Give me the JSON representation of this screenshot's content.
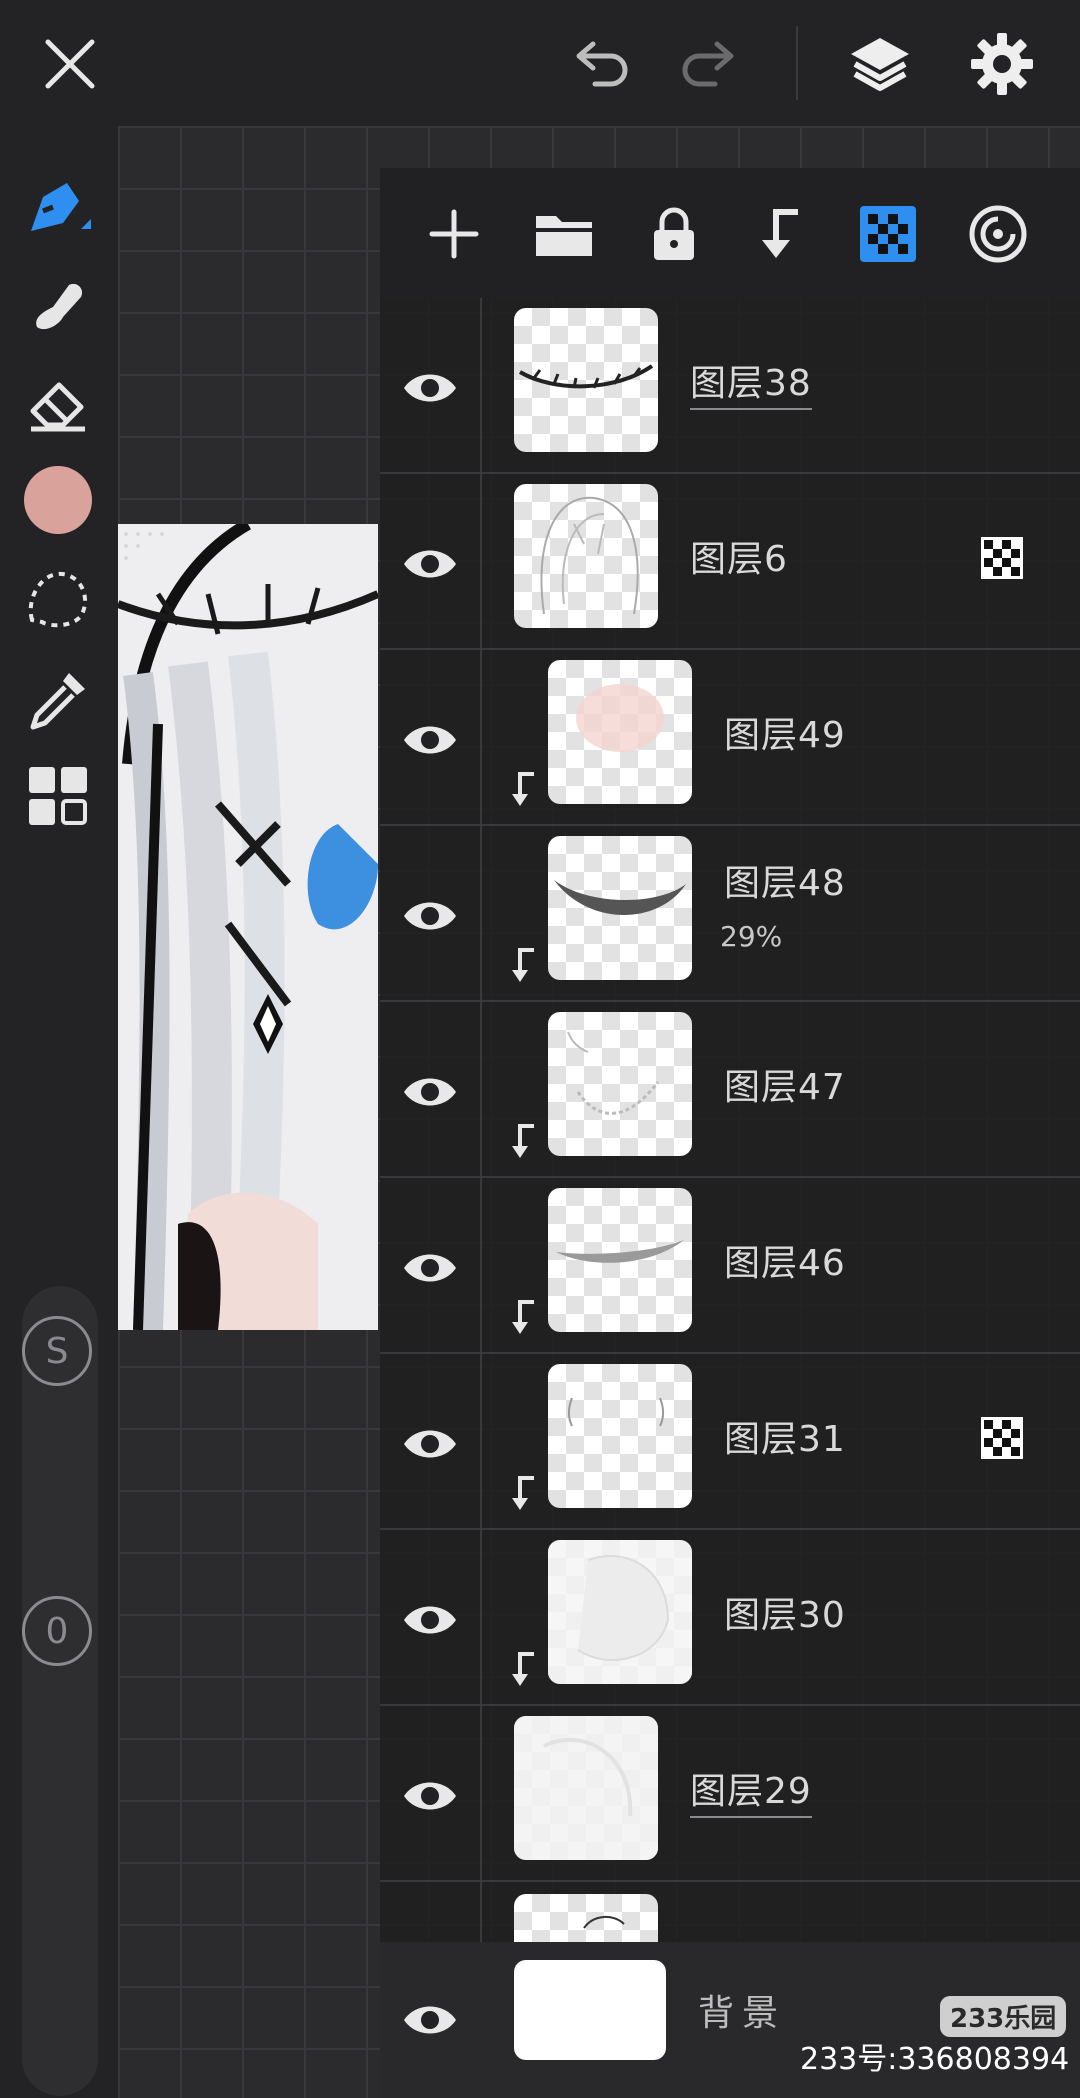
{
  "colors": {
    "accent": "#2f8ff0",
    "current_color": "#d9a29a"
  },
  "top_bar": {
    "close": "close-icon",
    "undo": "undo-icon",
    "redo": "redo-icon",
    "layers": "layers-icon",
    "settings": "gear-icon"
  },
  "left_tools": {
    "items": [
      "pen-tool-icon",
      "smudge-tool-icon",
      "eraser-icon",
      "color-swatch",
      "lasso-selection-icon",
      "eyedropper-icon",
      "materials-grid-icon"
    ],
    "size_button": "S",
    "opacity_button": "0"
  },
  "layer_panel": {
    "actions": [
      "add-layer-icon",
      "folder-icon",
      "lock-icon",
      "clip-arrow-icon",
      "alpha-lock-icon",
      "blend-target-icon"
    ],
    "layers": [
      {
        "name": "图层38",
        "clipped": false,
        "opacity": "",
        "mask": false
      },
      {
        "name": "图层6",
        "clipped": false,
        "opacity": "",
        "mask": true
      },
      {
        "name": "图层49",
        "clipped": true,
        "opacity": "",
        "mask": false
      },
      {
        "name": "图层48",
        "clipped": true,
        "opacity": "29%",
        "mask": false
      },
      {
        "name": "图层47",
        "clipped": true,
        "opacity": "",
        "mask": false
      },
      {
        "name": "图层46",
        "clipped": true,
        "opacity": "",
        "mask": false
      },
      {
        "name": "图层31",
        "clipped": true,
        "opacity": "",
        "mask": true
      },
      {
        "name": "图层30",
        "clipped": true,
        "opacity": "",
        "mask": false
      },
      {
        "name": "图层29",
        "clipped": false,
        "opacity": "",
        "mask": false
      }
    ],
    "background_label": "背景"
  },
  "watermark": {
    "badge": "233乐园",
    "text": "233号:336808394"
  }
}
